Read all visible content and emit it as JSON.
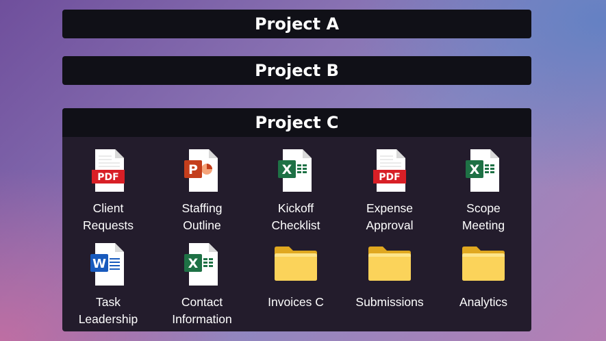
{
  "projects": [
    {
      "title": "Project A",
      "expanded": false
    },
    {
      "title": "Project B",
      "expanded": false
    },
    {
      "title": "Project C",
      "expanded": true,
      "items": [
        {
          "label": "Client\nRequests",
          "icon": "pdf-file-icon"
        },
        {
          "label": "Staffing\nOutline",
          "icon": "powerpoint-file-icon"
        },
        {
          "label": "Kickoff\nChecklist",
          "icon": "excel-file-icon"
        },
        {
          "label": "Expense\nApproval",
          "icon": "pdf-file-icon"
        },
        {
          "label": "Scope\nMeeting",
          "icon": "excel-file-icon"
        },
        {
          "label": "Task\nLeadership",
          "icon": "word-file-icon"
        },
        {
          "label": "Contact\nInformation",
          "icon": "excel-file-icon"
        },
        {
          "label": "Invoices C",
          "icon": "folder-icon"
        },
        {
          "label": "Submissions",
          "icon": "folder-icon"
        },
        {
          "label": "Analytics",
          "icon": "folder-icon"
        }
      ]
    }
  ],
  "icon_texts": {
    "pdf": "PDF",
    "powerpoint": "P",
    "excel": "X",
    "word": "W"
  },
  "colors": {
    "header_bg": "#101017",
    "panel_bg": "#231c2c",
    "pdf_red": "#d81f26",
    "powerpoint_orange": "#c43e1c",
    "excel_green": "#1e7145",
    "word_blue": "#185abd",
    "folder_yellow": "#fbd35a"
  }
}
